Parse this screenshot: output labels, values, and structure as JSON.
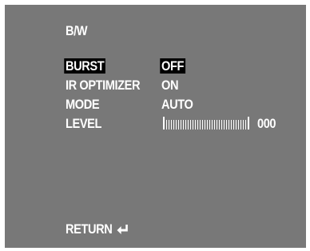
{
  "menu": {
    "title": "B/W",
    "items": [
      {
        "label": "BURST",
        "value": "OFF",
        "selected": true
      },
      {
        "label": "IR OPTIMIZER",
        "value": "ON",
        "selected": false
      },
      {
        "label": "MODE",
        "value": "AUTO",
        "selected": false
      },
      {
        "label": "LEVEL",
        "value": "000",
        "selected": false
      }
    ],
    "level_fill_fraction": 0.0,
    "return_label": "RETURN",
    "return_icon": "enter-return-icon",
    "colors": {
      "background": "#787878",
      "text": "#ffffff",
      "highlight": "#000000"
    }
  }
}
